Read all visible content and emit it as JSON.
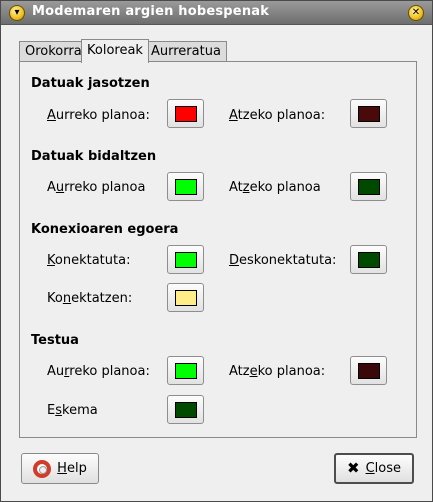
{
  "window": {
    "title": "Modemaren argien hobespenak"
  },
  "tabs": [
    "Orokorra",
    "Koloreak",
    "Aurreratua"
  ],
  "sections": [
    {
      "title": "Datuak jasotzen",
      "rows": [
        {
          "label_ul": "A",
          "label_rest": "urreko planoa:",
          "color": "#ff0000"
        },
        {
          "label_ul": "A",
          "label_rest": "tzeko planoa:",
          "color": "#4a0a0a"
        }
      ]
    },
    {
      "title": "Datuak bidaltzen",
      "rows": [
        {
          "label_pre": "A",
          "label_ul": "u",
          "label_rest": "rreko planoa",
          "color": "#00ff00"
        },
        {
          "label_pre": "At",
          "label_ul": "z",
          "label_rest": "eko planoa",
          "color": "#004a00"
        }
      ]
    },
    {
      "title": "Konexioaren egoera",
      "rows": [
        {
          "label_ul": "K",
          "label_rest": "onektatuta:",
          "color": "#00ff00"
        },
        {
          "label_ul": "D",
          "label_rest": "eskonektatuta:",
          "color": "#004a00"
        },
        {
          "label_pre": "Ko",
          "label_ul": "n",
          "label_rest": "ektatzen:",
          "color": "#ffee88"
        }
      ]
    },
    {
      "title": "Testua",
      "rows": [
        {
          "label_pre": "Au",
          "label_ul": "r",
          "label_rest": "reko planoa:",
          "color": "#00ff00"
        },
        {
          "label_pre": "Atz",
          "label_ul": "e",
          "label_rest": "ko planoa:",
          "color": "#3a0808"
        },
        {
          "label_pre": "E",
          "label_ul": "s",
          "label_rest": "kema",
          "color": "#004a00"
        }
      ]
    }
  ],
  "buttons": {
    "help_ul": "H",
    "help_rest": "elp",
    "close_ul": "C",
    "close_rest": "lose"
  }
}
